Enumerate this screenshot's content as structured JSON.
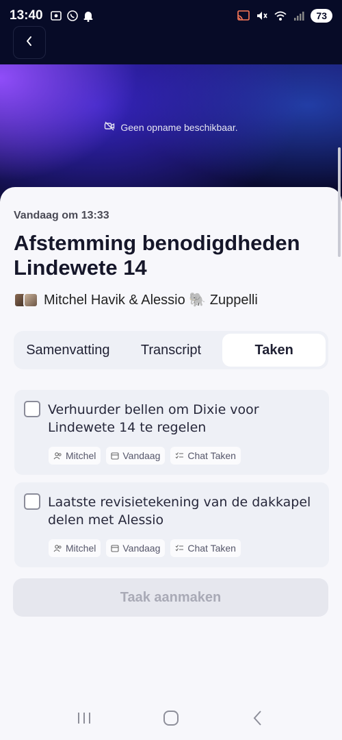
{
  "status_bar": {
    "time": "13:40",
    "battery": "73",
    "icons_left": [
      "screen-record-icon",
      "whatsapp-icon",
      "notification-bell-icon"
    ],
    "icons_right": [
      "cast-icon",
      "mute-icon",
      "wifi-icon",
      "signal-icon"
    ]
  },
  "header": {
    "back_icon": "chevron-left-icon"
  },
  "banner": {
    "no_recording_text": "Geen opname beschikbaar."
  },
  "meeting": {
    "date": "Vandaag om 13:33",
    "title": "Afstemming benodigdheden Lindewete 14",
    "participants": "Mitchel Havik & Alessio 🐘 Zuppelli"
  },
  "tabs": [
    {
      "label": "Samenvatting",
      "active": false
    },
    {
      "label": "Transcript",
      "active": false
    },
    {
      "label": "Taken",
      "active": true
    }
  ],
  "tasks": [
    {
      "text": "Verhuurder bellen om Dixie voor Lindewete 14 te regelen",
      "assignee": "Mitchel",
      "due": "Vandaag",
      "source": "Chat Taken"
    },
    {
      "text": "Laatste revisietekening van de dakkapel delen met Alessio",
      "assignee": "Mitchel",
      "due": "Vandaag",
      "source": "Chat Taken"
    }
  ],
  "create_button": "Taak aanmaken",
  "colors": {
    "header_bg": "#070b27",
    "tab_bg": "#eef0f6",
    "card_bg": "#eef0f6"
  }
}
